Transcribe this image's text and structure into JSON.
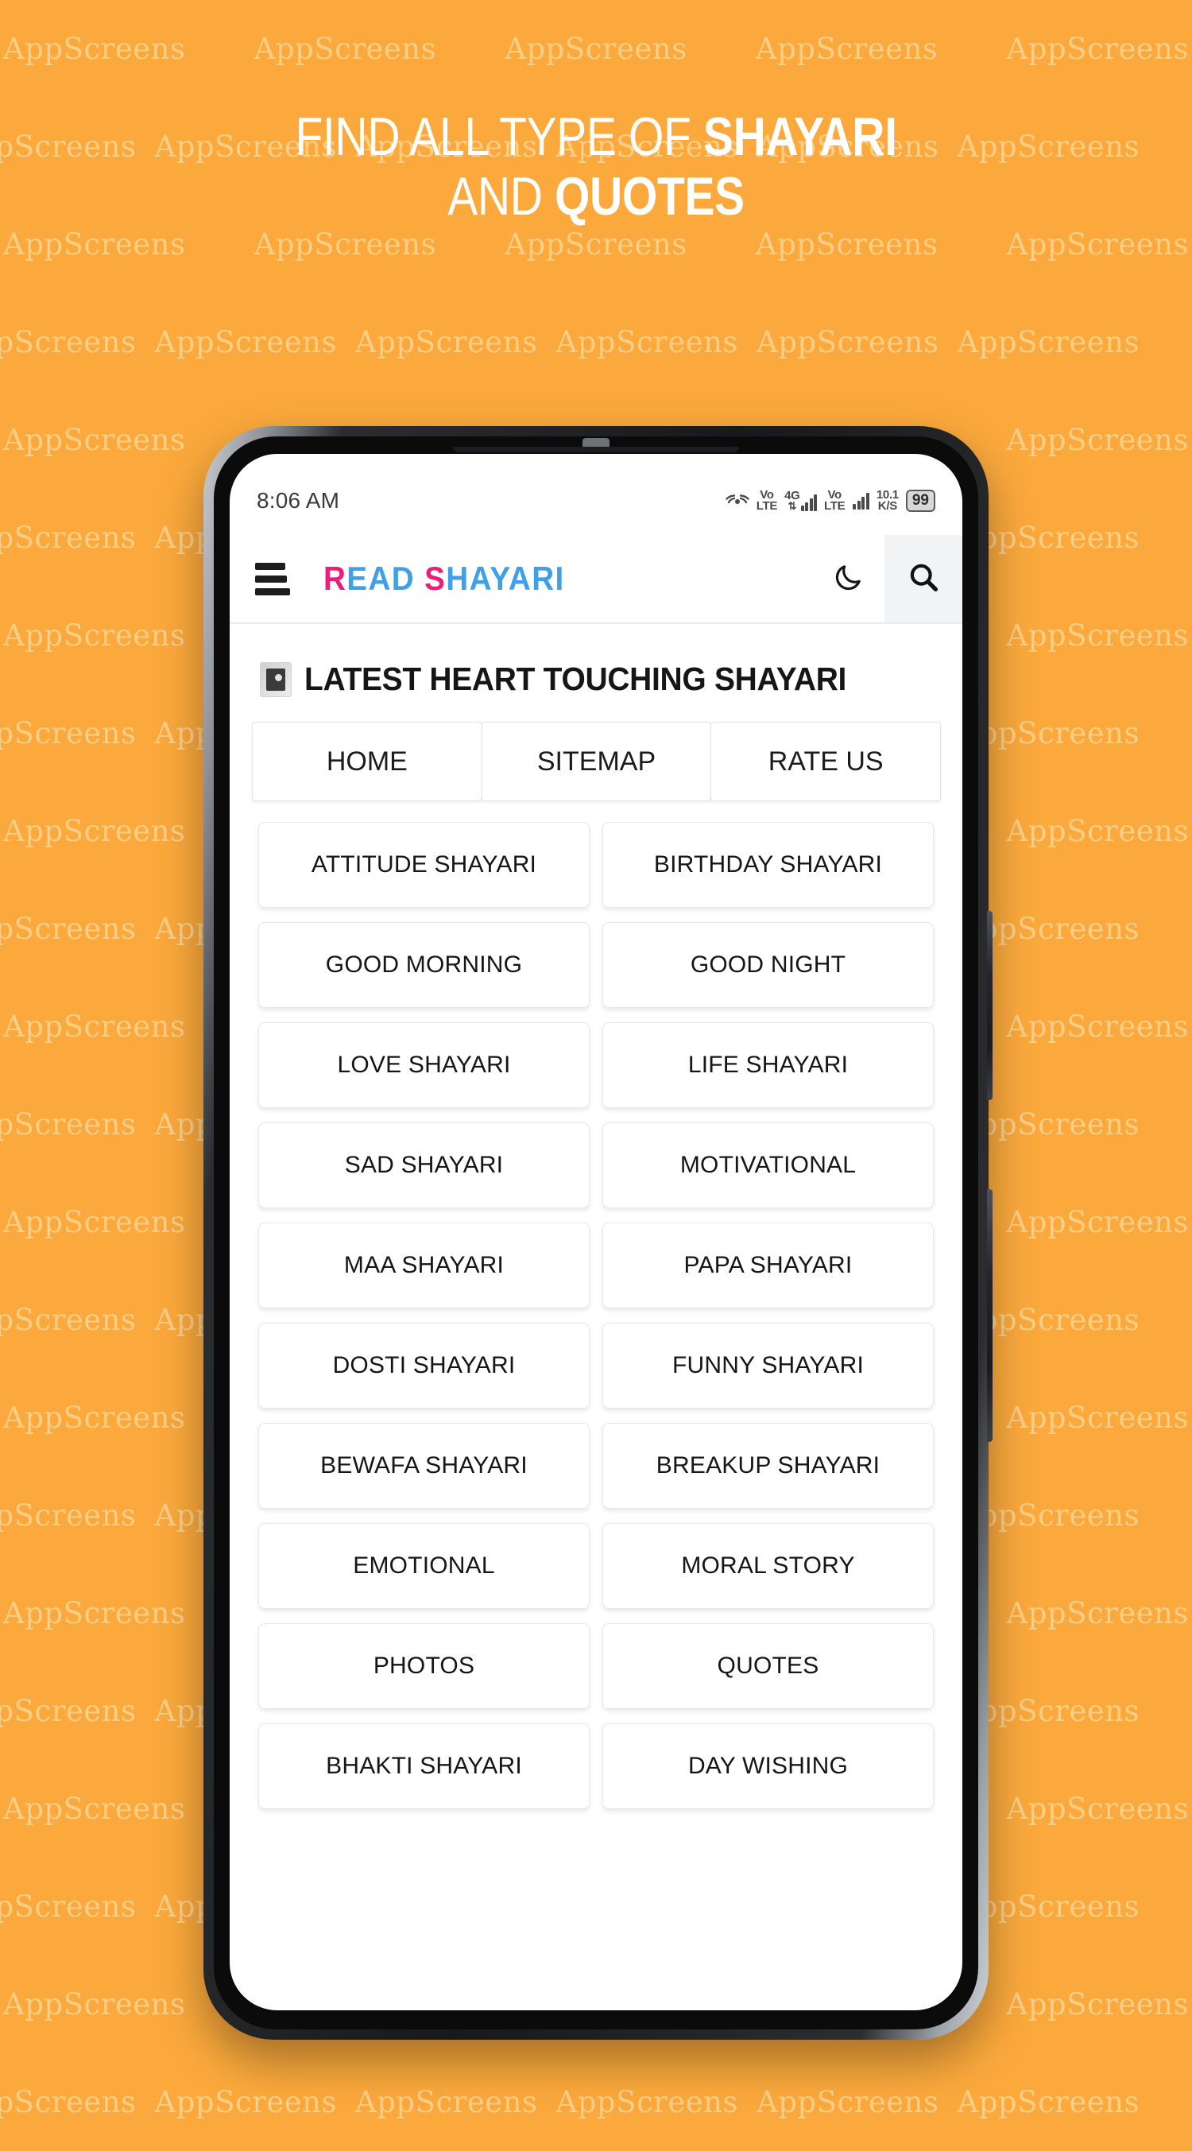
{
  "background": {
    "color": "#FBA93C",
    "watermark_text": "AppScreens",
    "watermark_color": "#FDCE86"
  },
  "headline": {
    "line1_light": "FIND ALL TYPE OF ",
    "line1_bold": "SHAYARI",
    "line2_light": "AND ",
    "line2_bold": "QUOTES"
  },
  "phone": {
    "statusbar": {
      "clock": "8:06 AM",
      "wifi_icon": "wifi-icon",
      "volte1_top": "Vo",
      "volte1_bottom": "LTE",
      "network_top": "4G",
      "network_bottom": "",
      "volte2_top": "Vo",
      "volte2_bottom": "LTE",
      "datarate_top": "10.1",
      "datarate_bottom": "K/S",
      "battery": "99"
    },
    "appbar": {
      "menu_icon": "hamburger-menu-icon",
      "logo_part1": "R",
      "logo_part2": "EAD ",
      "logo_part3": "S",
      "logo_part4": "HAYARI",
      "logo_pink": "#ED1E79",
      "logo_blue": "#3FA0E8",
      "moon_icon": "moon-icon",
      "search_icon": "search-icon"
    },
    "section": {
      "thumb_icon": "article-thumbnail-icon",
      "title": "LATEST HEART TOUCHING SHAYARI"
    },
    "tabs": [
      {
        "label": "HOME"
      },
      {
        "label": "SITEMAP"
      },
      {
        "label": "RATE US"
      }
    ],
    "categories": [
      {
        "label": "ATTITUDE SHAYARI"
      },
      {
        "label": "BIRTHDAY SHAYARI"
      },
      {
        "label": "GOOD MORNING"
      },
      {
        "label": "GOOD NIGHT"
      },
      {
        "label": "LOVE SHAYARI"
      },
      {
        "label": "LIFE SHAYARI"
      },
      {
        "label": "SAD SHAYARI"
      },
      {
        "label": "MOTIVATIONAL"
      },
      {
        "label": "MAA SHAYARI"
      },
      {
        "label": "PAPA SHAYARI"
      },
      {
        "label": "DOSTI SHAYARI"
      },
      {
        "label": "FUNNY SHAYARI"
      },
      {
        "label": "BEWAFA SHAYARI"
      },
      {
        "label": "BREAKUP SHAYARI"
      },
      {
        "label": "EMOTIONAL"
      },
      {
        "label": "MORAL STORY"
      },
      {
        "label": "PHOTOS"
      },
      {
        "label": "QUOTES"
      },
      {
        "label": "BHAKTI SHAYARI"
      },
      {
        "label": "DAY WISHING"
      }
    ]
  }
}
